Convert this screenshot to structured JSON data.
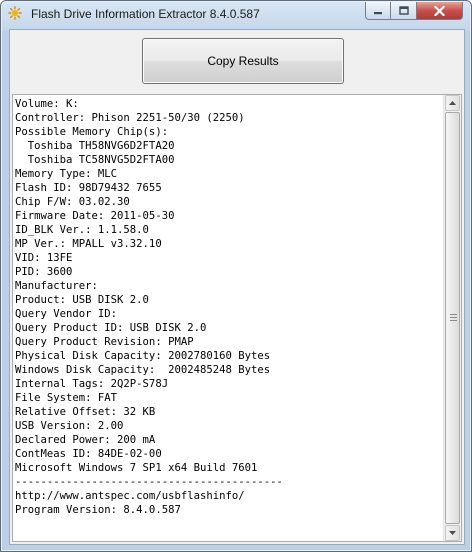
{
  "window": {
    "title": "Flash Drive Information Extractor 8.4.0.587",
    "controls": {
      "minimize_icon": "minimize-icon",
      "maximize_icon": "maximize-icon",
      "close_icon": "close-icon"
    }
  },
  "toolbar": {
    "copy_label": "Copy Results"
  },
  "results": {
    "lines": [
      "Volume: K:",
      "Controller: Phison 2251-50/30 (2250)",
      "Possible Memory Chip(s):",
      "  Toshiba TH58NVG6D2FTA20",
      "  Toshiba TC58NVG5D2FTA00",
      "Memory Type: MLC",
      "Flash ID: 98D79432 7655",
      "Chip F/W: 03.02.30",
      "Firmware Date: 2011-05-30",
      "ID_BLK Ver.: 1.1.58.0",
      "MP Ver.: MPALL v3.32.10",
      "VID: 13FE",
      "PID: 3600",
      "Manufacturer:",
      "Product: USB DISK 2.0",
      "Query Vendor ID:",
      "Query Product ID: USB DISK 2.0",
      "Query Product Revision: PMAP",
      "Physical Disk Capacity: 2002780160 Bytes",
      "Windows Disk Capacity:  2002485248 Bytes",
      "Internal Tags: 2Q2P-S78J",
      "File System: FAT",
      "Relative Offset: 32 KB",
      "USB Version: 2.00",
      "Declared Power: 200 mA",
      "ContMeas ID: 84DE-02-00",
      "Microsoft Windows 7 SP1 x64 Build 7601",
      "------------------------------------------",
      "http://www.antspec.com/usbflashinfo/",
      "Program Version: 8.4.0.587"
    ]
  },
  "colors": {
    "title_bar": "#c3d6ea",
    "close_button": "#c75050",
    "text": "#000000"
  }
}
